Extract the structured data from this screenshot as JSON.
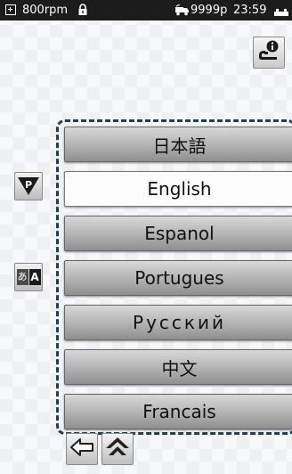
{
  "status": {
    "rpm": "800rpm",
    "count": "9999p",
    "time": "23:59"
  },
  "languages": [
    "日本語",
    "English",
    "Espanol",
    "Portugues",
    "Русский",
    "中文",
    "Francais"
  ],
  "selected_language": "English",
  "side_buttons": {
    "p_label": "P",
    "conv_left": "あ",
    "conv_right": "A"
  },
  "icons": {
    "status_plus": "plus-square-icon",
    "status_lock": "lock-icon",
    "status_vehicle": "vehicle-icon",
    "status_battery": "battery-icon",
    "info": "info-icon",
    "back": "back-arrow-icon",
    "home": "home-icon"
  },
  "colors": {
    "frame": "#1f3e5a",
    "status_bar": "#1c1c1c",
    "selected_bg": "#fdfdfd",
    "button_bg": "#b1b1b1"
  }
}
